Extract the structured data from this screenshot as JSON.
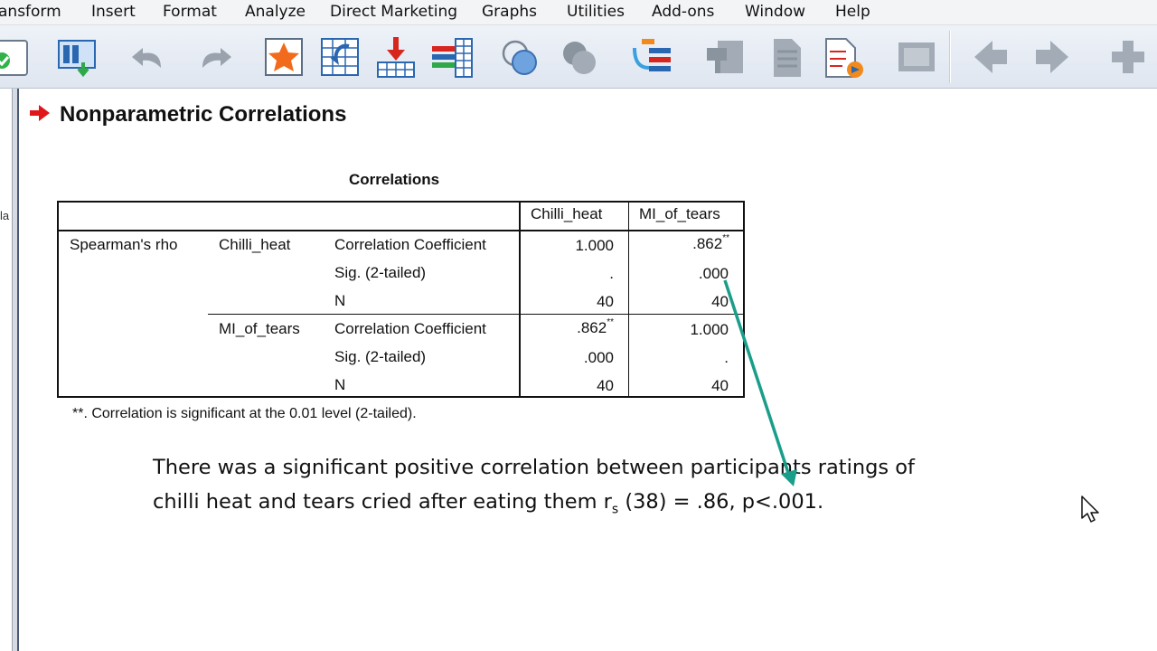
{
  "menu": {
    "items": [
      {
        "label": "ansform",
        "name": "menu-transform"
      },
      {
        "label": "Insert",
        "name": "menu-insert"
      },
      {
        "label": "Format",
        "name": "menu-format"
      },
      {
        "label": "Analyze",
        "name": "menu-analyze"
      },
      {
        "label": "Direct Marketing",
        "name": "menu-direct-marketing"
      },
      {
        "label": "Graphs",
        "name": "menu-graphs"
      },
      {
        "label": "Utilities",
        "name": "menu-utilities"
      },
      {
        "label": "Add-ons",
        "name": "menu-add-ons"
      },
      {
        "label": "Window",
        "name": "menu-window"
      },
      {
        "label": "Help",
        "name": "menu-help"
      }
    ]
  },
  "toolbar": {
    "icons": [
      "open-data-icon",
      "variables-icon",
      "undo-icon",
      "redo-icon",
      "select-cases-icon",
      "goto-case-icon",
      "insert-variable-icon",
      "split-file-icon",
      "value-labels-icon",
      "use-sets-icon",
      "show-all-icon",
      "promote-icon",
      "demote-icon",
      "export-icon",
      "designate-window-icon",
      "collapse-icon",
      "back-icon",
      "forward-icon",
      "expand-icon"
    ]
  },
  "left_pane": {
    "fragment": "la"
  },
  "output": {
    "title": "Nonparametric Correlations",
    "table": {
      "caption": "Correlations",
      "col_headers": [
        "Chilli_heat",
        "MI_of_tears"
      ],
      "row_group": "Spearman's rho",
      "row_vars": [
        "Chilli_heat",
        "MI_of_tears"
      ],
      "stats": [
        "Correlation Coefficient",
        "Sig. (2-tailed)",
        "N"
      ],
      "rows": [
        {
          "var": "Chilli_heat",
          "cells": [
            [
              "1.000",
              ".862"
            ],
            [
              ".",
              ".000"
            ],
            [
              "40",
              "40"
            ]
          ]
        },
        {
          "var": "MI_of_tears",
          "cells": [
            [
              ".862",
              "1.000"
            ],
            [
              ".000",
              "."
            ],
            [
              "40",
              "40"
            ]
          ]
        }
      ],
      "sig_mark": "**",
      "footnote": "**. Correlation is significant at the 0.01 level (2-tailed)."
    },
    "annotation": {
      "line1": "There was a significant positive correlation between participants ratings of",
      "line2_a": "chilli heat and tears cried after eating them r",
      "line2_sub": "s",
      "line2_b": " (38) = .86, p<.001."
    }
  },
  "colors": {
    "callout_arrow": "#1a9e8a",
    "marker_red": "#e0161b",
    "toolbar_bg": "#e6ebf2"
  }
}
